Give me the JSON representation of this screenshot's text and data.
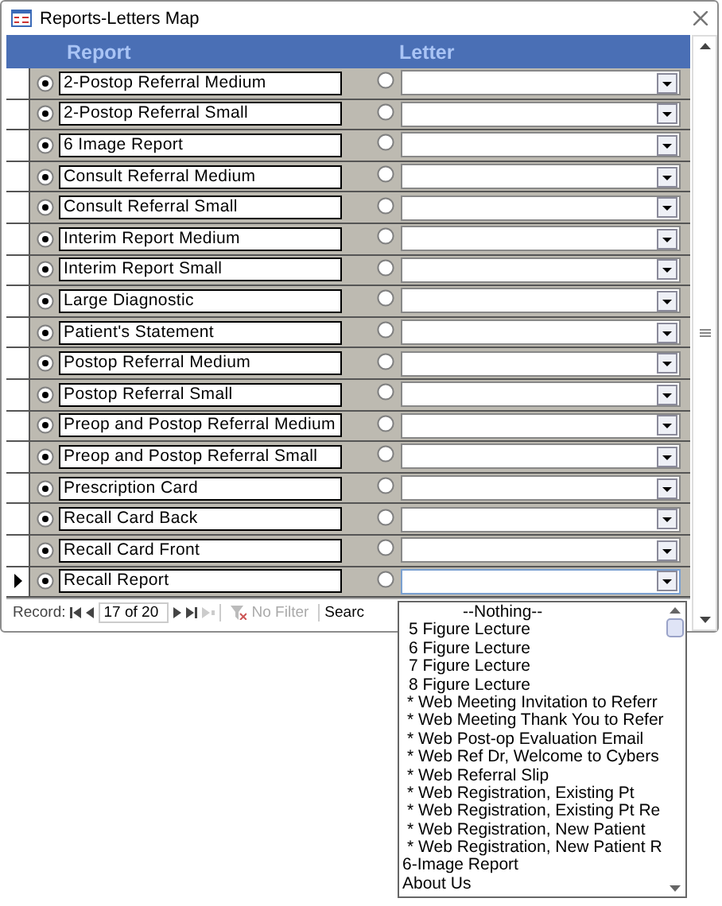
{
  "window": {
    "title": "Reports-Letters Map"
  },
  "columns": [
    "Report",
    "Letter"
  ],
  "rows": [
    {
      "report": "2-Postop Referral Medium",
      "report_option_selected": true,
      "letter_option_selected": false,
      "current": false
    },
    {
      "report": "2-Postop Referral Small",
      "report_option_selected": true,
      "letter_option_selected": false,
      "current": false
    },
    {
      "report": "6 Image Report",
      "report_option_selected": true,
      "letter_option_selected": false,
      "current": false
    },
    {
      "report": "Consult Referral Medium",
      "report_option_selected": true,
      "letter_option_selected": false,
      "current": false
    },
    {
      "report": "Consult Referral Small",
      "report_option_selected": true,
      "letter_option_selected": false,
      "current": false
    },
    {
      "report": "Interim Report Medium",
      "report_option_selected": true,
      "letter_option_selected": false,
      "current": false
    },
    {
      "report": "Interim Report Small",
      "report_option_selected": true,
      "letter_option_selected": false,
      "current": false
    },
    {
      "report": "Large Diagnostic",
      "report_option_selected": true,
      "letter_option_selected": false,
      "current": false
    },
    {
      "report": "Patient's Statement",
      "report_option_selected": true,
      "letter_option_selected": false,
      "current": false
    },
    {
      "report": "Postop Referral Medium",
      "report_option_selected": true,
      "letter_option_selected": false,
      "current": false
    },
    {
      "report": "Postop Referral Small",
      "report_option_selected": true,
      "letter_option_selected": false,
      "current": false
    },
    {
      "report": "Preop and Postop Referral Medium",
      "report_option_selected": true,
      "letter_option_selected": false,
      "current": false
    },
    {
      "report": "Preop and Postop Referral Small",
      "report_option_selected": true,
      "letter_option_selected": false,
      "current": false
    },
    {
      "report": "Prescription Card",
      "report_option_selected": true,
      "letter_option_selected": false,
      "current": false
    },
    {
      "report": "Recall Card Back",
      "report_option_selected": true,
      "letter_option_selected": false,
      "current": false
    },
    {
      "report": "Recall Card Front",
      "report_option_selected": true,
      "letter_option_selected": false,
      "current": false
    },
    {
      "report": "Recall Report",
      "report_option_selected": true,
      "letter_option_selected": false,
      "current": true
    }
  ],
  "navigation": {
    "label": "Record:",
    "position": "17 of 20",
    "new_disabled": true,
    "filter": "No Filter",
    "filter_disabled": true,
    "search": "Searc"
  },
  "dropdown": {
    "items": [
      "--Nothing--",
      "5 Figure Lecture",
      "6 Figure Lecture",
      "7 Figure Lecture",
      "8 Figure Lecture",
      "* Web Meeting Invitation to Referr",
      "* Web Meeting Thank You to Refer",
      "* Web Post-op Evaluation Email",
      "* Web Ref Dr, Welcome to Cybers",
      "* Web Referral Slip",
      "* Web Registration, Existing Pt",
      "* Web Registration, Existing Pt Re",
      "* Web Registration, New Patient",
      "* Web Registration, New Patient R",
      "6-Image Report",
      "About Us"
    ]
  }
}
